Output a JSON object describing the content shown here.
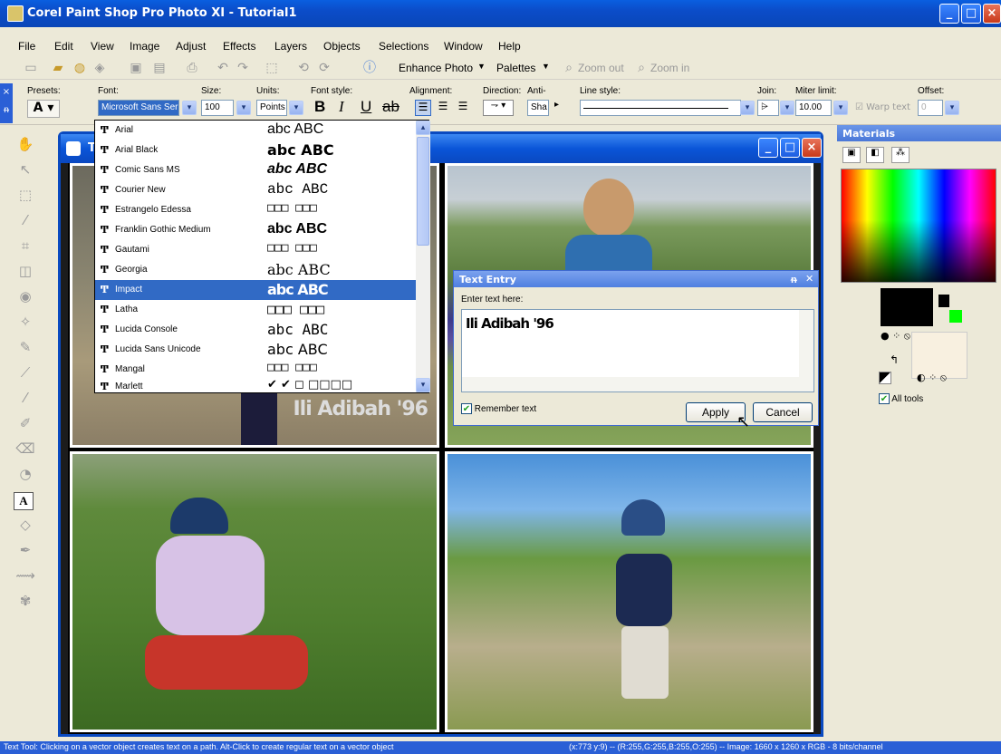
{
  "app": {
    "title": "Corel Paint Shop Pro Photo XI - Tutorial1"
  },
  "menu": [
    "File",
    "Edit",
    "View",
    "Image",
    "Adjust",
    "Effects",
    "Layers",
    "Objects",
    "Selections",
    "Window",
    "Help"
  ],
  "toolbar": {
    "enhance_photo": "Enhance Photo",
    "palettes": "Palettes",
    "zoom_out": "Zoom out",
    "zoom_in": "Zoom in"
  },
  "text_options": {
    "presets_label": "Presets:",
    "font_label": "Font:",
    "font_value": "Microsoft Sans Serif",
    "size_label": "Size:",
    "size_value": "100",
    "units_label": "Units:",
    "units_value": "Points",
    "font_style_label": "Font style:",
    "alignment_label": "Alignment:",
    "direction_label": "Direction:",
    "anti_label": "Anti-",
    "anti_value": "Sha",
    "line_style_label": "Line style:",
    "join_label": "Join:",
    "miter_label": "Miter limit:",
    "miter_value": "10.00",
    "warp_text_label": "Warp text",
    "offset_label": "Offset:",
    "offset_value": "0"
  },
  "font_list": [
    {
      "name": "Arial",
      "sample": "abc ABC",
      "selected": false
    },
    {
      "name": "Arial Black",
      "sample": "abc ABC",
      "selected": false
    },
    {
      "name": "Comic Sans MS",
      "sample": "abc ABC",
      "selected": false
    },
    {
      "name": "Courier New",
      "sample": "abc ABC",
      "selected": false
    },
    {
      "name": "Estrangelo Edessa",
      "sample": "□□□ □□□",
      "selected": false
    },
    {
      "name": "Franklin Gothic Medium",
      "sample": "abc ABC",
      "selected": false
    },
    {
      "name": "Gautami",
      "sample": "□□□ □□□",
      "selected": false
    },
    {
      "name": "Georgia",
      "sample": "abc ABC",
      "selected": false
    },
    {
      "name": "Impact",
      "sample": "abc ABC",
      "selected": true
    },
    {
      "name": "Latha",
      "sample": "□□□ □□□",
      "selected": false
    },
    {
      "name": "Lucida Console",
      "sample": "abc ABC",
      "selected": false
    },
    {
      "name": "Lucida Sans Unicode",
      "sample": "abc ABC",
      "selected": false
    },
    {
      "name": "Mangal",
      "sample": "□□□ □□□",
      "selected": false
    },
    {
      "name": "Marlett",
      "sample": "✔ ✔ ◻ □□□□",
      "selected": false
    }
  ],
  "document": {
    "title": "T",
    "overlay_text": "Ili Adibah '96"
  },
  "text_entry": {
    "title": "Text Entry",
    "prompt": "Enter text here:",
    "value": "Ili Adibah '96",
    "remember_label": "Remember text",
    "apply_label": "Apply",
    "cancel_label": "Cancel"
  },
  "materials": {
    "title": "Materials",
    "all_tools_label": "All tools"
  },
  "status": {
    "left": "Text Tool: Clicking on a vector object creates text on a path. Alt-Click to create regular text on a vector object",
    "right": "(x:773 y:9) -- (R:255,G:255,B:255,O:255) -- Image:  1660 x 1260 x RGB - 8 bits/channel"
  },
  "colors": {
    "selection": "#316ac5",
    "titlebar": "#0a55d8",
    "fg_color": "#000000",
    "bg_color": "#00ff00"
  }
}
